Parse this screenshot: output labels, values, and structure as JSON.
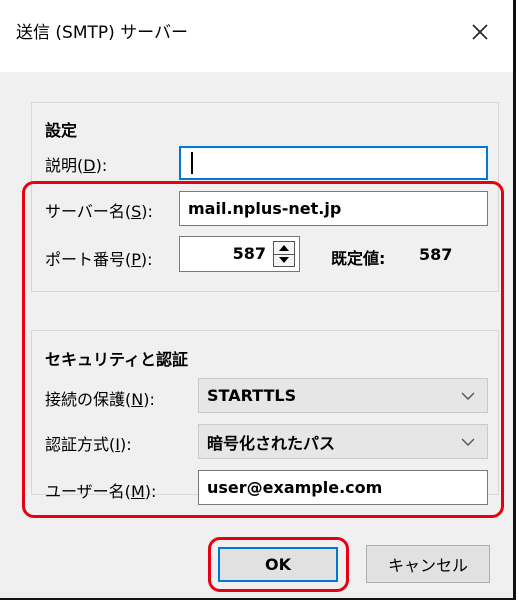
{
  "dialog": {
    "title": "送信 (SMTP) サーバー",
    "close_glyph": "✕"
  },
  "settings": {
    "group_title": "設定",
    "description": {
      "label": "説明(",
      "key": "D",
      "suffix": "):",
      "value": ""
    },
    "server": {
      "label": "サーバー名(",
      "key": "S",
      "suffix": "):",
      "value": "mail.nplus-net.jp"
    },
    "port": {
      "label": "ポート番号(",
      "key": "P",
      "suffix": "):",
      "value": "587",
      "default_label": "既定値:",
      "default_value": "587"
    }
  },
  "security": {
    "group_title": "セキュリティと認証",
    "connection": {
      "label": "接続の保護(",
      "key": "N",
      "suffix": "):",
      "value": "STARTTLS"
    },
    "auth": {
      "label": "認証方式(",
      "key": "I",
      "suffix": "):",
      "value": "暗号化されたパス"
    },
    "username": {
      "label": "ユーザー名(",
      "key": "M",
      "suffix": "):",
      "value": "user@example.com"
    }
  },
  "buttons": {
    "ok": "OK",
    "cancel": "キャンセル"
  },
  "colors": {
    "highlight": "#e60012",
    "focus": "#0078d7"
  },
  "icons": {
    "close": "close-icon",
    "spin_up": "triangle-up-icon",
    "spin_down": "triangle-down-icon",
    "dropdown": "chevron-down-icon"
  }
}
